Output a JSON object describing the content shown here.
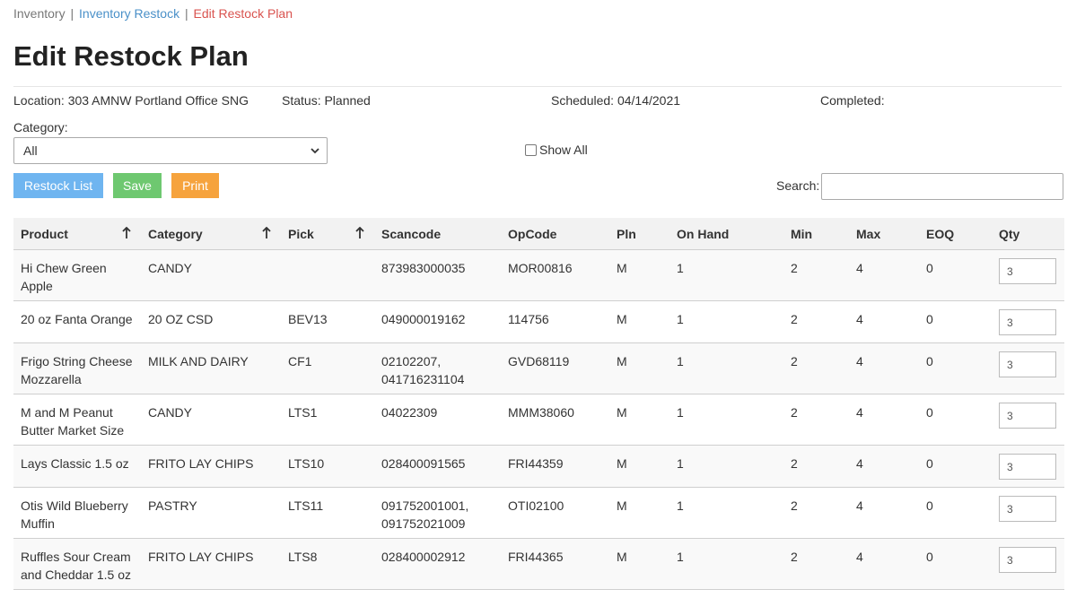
{
  "breadcrumb": {
    "root": "Inventory",
    "separator": "|",
    "parent": "Inventory Restock",
    "current": "Edit Restock Plan"
  },
  "page": {
    "title": "Edit Restock Plan"
  },
  "info": {
    "location": "Location: 303 AMNW Portland Office SNG",
    "status": "Status: Planned",
    "scheduled": "Scheduled: 04/14/2021",
    "completed": "Completed:"
  },
  "filters": {
    "category_label": "Category:",
    "category_value": "All",
    "show_all_label": "Show All",
    "show_all_checked": false
  },
  "buttons": {
    "restock_list": "Restock List",
    "save": "Save",
    "print": "Print"
  },
  "search": {
    "label": "Search:",
    "value": ""
  },
  "colors": {
    "restock_button": "#6fb5f0",
    "save_button": "#6ec870",
    "print_button": "#f6a33d",
    "breadcrumb_link": "#4a90c8",
    "breadcrumb_current": "#d9534f"
  },
  "icons": {
    "sort": "arrow-up-icon",
    "select": "chevron-down-icon"
  },
  "table": {
    "columns": [
      "Product",
      "Category",
      "Pick",
      "Scancode",
      "OpCode",
      "Pln",
      "On Hand",
      "Min",
      "Max",
      "EOQ",
      "Qty"
    ],
    "rows": [
      {
        "product": [
          "Hi Chew Green",
          "Apple"
        ],
        "category": "CANDY",
        "pick": "",
        "scancode": [
          "873983000035"
        ],
        "opcode": "MOR00816",
        "pln": "M",
        "on_hand": "1",
        "min": "2",
        "max": "4",
        "eoq": "0",
        "qty": "3"
      },
      {
        "product": [
          "20 oz Fanta Orange"
        ],
        "category": "20 OZ CSD",
        "pick": "BEV13",
        "scancode": [
          "049000019162"
        ],
        "opcode": "114756",
        "pln": "M",
        "on_hand": "1",
        "min": "2",
        "max": "4",
        "eoq": "0",
        "qty": "3"
      },
      {
        "product": [
          "Frigo String Cheese",
          "Mozzarella"
        ],
        "category": "MILK AND DAIRY",
        "pick": "CF1",
        "scancode": [
          "02102207,",
          "041716231104"
        ],
        "opcode": "GVD68119",
        "pln": "M",
        "on_hand": "1",
        "min": "2",
        "max": "4",
        "eoq": "0",
        "qty": "3"
      },
      {
        "product": [
          "M and M Peanut",
          "Butter Market Size"
        ],
        "category": "CANDY",
        "pick": "LTS1",
        "scancode": [
          "04022309"
        ],
        "opcode": "MMM38060",
        "pln": "M",
        "on_hand": "1",
        "min": "2",
        "max": "4",
        "eoq": "0",
        "qty": "3"
      },
      {
        "product": [
          "Lays Classic 1.5 oz"
        ],
        "category": "FRITO LAY CHIPS",
        "pick": "LTS10",
        "scancode": [
          "028400091565"
        ],
        "opcode": "FRI44359",
        "pln": "M",
        "on_hand": "1",
        "min": "2",
        "max": "4",
        "eoq": "0",
        "qty": "3"
      },
      {
        "product": [
          "Otis Wild Blueberry",
          "Muffin"
        ],
        "category": "PASTRY",
        "pick": "LTS11",
        "scancode": [
          "091752001001,",
          "091752021009"
        ],
        "opcode": "OTI02100",
        "pln": "M",
        "on_hand": "1",
        "min": "2",
        "max": "4",
        "eoq": "0",
        "qty": "3"
      },
      {
        "product": [
          "Ruffles Sour Cream",
          "and Cheddar 1.5 oz"
        ],
        "category": "FRITO LAY CHIPS",
        "pick": "LTS8",
        "scancode": [
          "028400002912"
        ],
        "opcode": "FRI44365",
        "pln": "M",
        "on_hand": "1",
        "min": "2",
        "max": "4",
        "eoq": "0",
        "qty": "3"
      }
    ]
  }
}
